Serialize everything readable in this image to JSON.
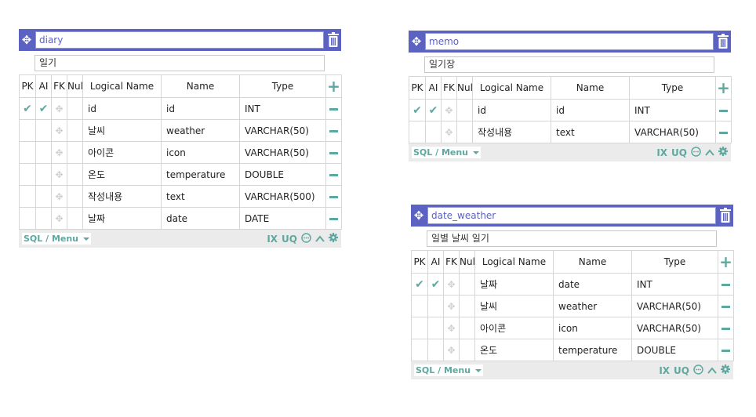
{
  "colors": {
    "header": "#5b62c1",
    "accent": "#5fa8a0",
    "border": "#d6d6d6",
    "footer": "#ebebeb"
  },
  "columns": [
    "PK",
    "AI",
    "FK",
    "Null",
    "Logical Name",
    "Name",
    "Type"
  ],
  "footer": {
    "sql_menu": "SQL / Menu",
    "ix": "IX",
    "uq": "UQ"
  },
  "icons": {
    "move": "move-arrows-icon",
    "trash": "trash-icon",
    "add": "plus-icon",
    "remove": "minus-icon",
    "check": "check-icon",
    "fk": "fk-move-icon",
    "comment": "comment-icon",
    "collapse": "chevron-up-icon",
    "settings": "gear-icon"
  },
  "tables": [
    {
      "name": "diary",
      "comment": "일기",
      "rows": [
        {
          "pk": true,
          "ai": true,
          "logical": "id",
          "name": "id",
          "type": "INT"
        },
        {
          "pk": false,
          "ai": false,
          "logical": "날씨",
          "name": "weather",
          "type": "VARCHAR(50)"
        },
        {
          "pk": false,
          "ai": false,
          "logical": "아이콘",
          "name": "icon",
          "type": "VARCHAR(50)"
        },
        {
          "pk": false,
          "ai": false,
          "logical": "온도",
          "name": "temperature",
          "type": "DOUBLE"
        },
        {
          "pk": false,
          "ai": false,
          "logical": "작성내용",
          "name": "text",
          "type": "VARCHAR(500)"
        },
        {
          "pk": false,
          "ai": false,
          "logical": "날짜",
          "name": "date",
          "type": "DATE"
        }
      ]
    },
    {
      "name": "memo",
      "comment": "일기장",
      "rows": [
        {
          "pk": true,
          "ai": true,
          "logical": "id",
          "name": "id",
          "type": "INT"
        },
        {
          "pk": false,
          "ai": false,
          "logical": "작성내용",
          "name": "text",
          "type": "VARCHAR(50)"
        }
      ]
    },
    {
      "name": "date_weather",
      "comment": "일별 날씨 일기",
      "rows": [
        {
          "pk": true,
          "ai": true,
          "logical": "날짜",
          "name": "date",
          "type": "INT"
        },
        {
          "pk": false,
          "ai": false,
          "logical": "날씨",
          "name": "weather",
          "type": "VARCHAR(50)"
        },
        {
          "pk": false,
          "ai": false,
          "logical": "아이콘",
          "name": "icon",
          "type": "VARCHAR(50)"
        },
        {
          "pk": false,
          "ai": false,
          "logical": "온도",
          "name": "temperature",
          "type": "DOUBLE"
        }
      ]
    }
  ]
}
